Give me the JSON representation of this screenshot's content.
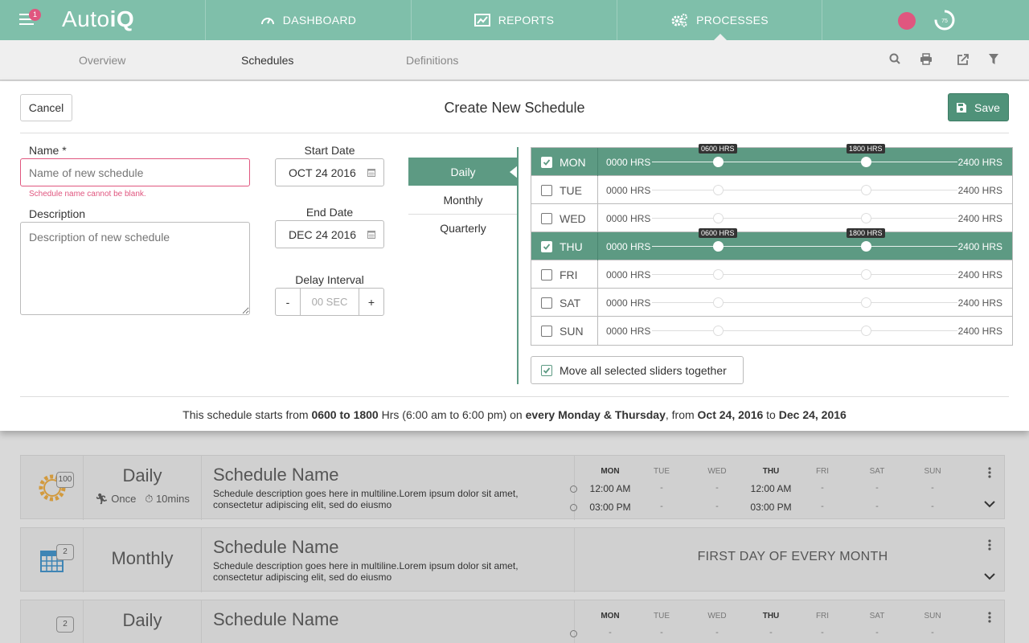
{
  "app": {
    "logo_plain": "Auto",
    "logo_bold": "iQ",
    "notification_count": "1",
    "progress_value": "75",
    "accent_color": "#7fbfaa",
    "alert_color": "#e0567f"
  },
  "nav": {
    "dashboard": "DASHBOARD",
    "reports": "REPORTS",
    "processes": "PROCESSES",
    "active": "PROCESSES"
  },
  "subnav": {
    "overview": "Overview",
    "schedules": "Schedules",
    "definitions": "Definitions",
    "active": "Schedules",
    "icons": [
      "search-icon",
      "print-icon",
      "export-icon",
      "filter-icon"
    ]
  },
  "modal": {
    "cancel_label": "Cancel",
    "title": "Create New Schedule",
    "save_label": "Save",
    "name_label": "Name *",
    "name_placeholder": "Name of new schedule",
    "name_error": "Schedule name cannot be blank.",
    "description_label": "Description",
    "description_placeholder": "Description of new schedule",
    "start_date_label": "Start Date",
    "start_date_value": "OCT 24 2016",
    "end_date_label": "End Date",
    "end_date_value": "DEC 24 2016",
    "delay_label": "Delay Interval",
    "delay_minus": "-",
    "delay_placeholder": "00 SEC",
    "delay_plus": "+",
    "frequency_tabs": [
      "Daily",
      "Monthly",
      "Quarterly"
    ],
    "frequency_active": "Daily",
    "days": [
      {
        "label": "MON",
        "checked": true,
        "start": "0000 HRS",
        "end": "2400 HRS",
        "from": "0600 HRS",
        "to": "1800 HRS"
      },
      {
        "label": "TUE",
        "checked": false,
        "start": "0000 HRS",
        "end": "2400 HRS"
      },
      {
        "label": "WED",
        "checked": false,
        "start": "0000 HRS",
        "end": "2400 HRS"
      },
      {
        "label": "THU",
        "checked": true,
        "start": "0000 HRS",
        "end": "2400 HRS",
        "from": "0600 HRS",
        "to": "1800 HRS"
      },
      {
        "label": "FRI",
        "checked": false,
        "start": "0000 HRS",
        "end": "2400 HRS"
      },
      {
        "label": "SAT",
        "checked": false,
        "start": "0000 HRS",
        "end": "2400 HRS"
      },
      {
        "label": "SUN",
        "checked": false,
        "start": "0000 HRS",
        "end": "2400 HRS"
      }
    ],
    "slider_from_hours": 6,
    "slider_to_hours": 18,
    "move_together_label": "Move all selected sliders together",
    "move_together_checked": true,
    "summary": {
      "p1": "This schedule starts from ",
      "b1": "0600 to 1800",
      "p2": " Hrs (6:00 am to 6:00 pm) on ",
      "b2": "every Monday & Thursday",
      "p3": ", from ",
      "b3": "Oct 24, 2016",
      "p4": " to ",
      "b4": "Dec 24, 2016"
    }
  },
  "list": {
    "weekdays": [
      "MON",
      "TUE",
      "WED",
      "THU",
      "FRI",
      "SAT",
      "SUN"
    ],
    "items": [
      {
        "count": "100",
        "type": "Daily",
        "mode": "Once",
        "interval": "10mins",
        "name": "Schedule Name",
        "description": "Schedule description goes here in multiline.Lorem ipsum dolor sit amet, consectetur adipiscing elit, sed do eiusmo",
        "rows": [
          [
            "12:00 AM",
            "-",
            "-",
            "12:00 AM",
            "-",
            "-",
            "-"
          ],
          [
            "03:00 PM",
            "-",
            "-",
            "03:00 PM",
            "-",
            "-",
            "-"
          ]
        ]
      },
      {
        "count": "2",
        "type": "Monthly",
        "name": "Schedule Name",
        "description": "Schedule description goes here in multiline.Lorem ipsum dolor sit amet, consectetur adipiscing elit, sed do eiusmo",
        "monthly_text": "FIRST DAY OF EVERY MONTH"
      },
      {
        "count": "2",
        "type": "Daily",
        "name": "Schedule Name",
        "rows": [
          [
            "-",
            "-",
            "-",
            "-",
            "-",
            "-",
            "-"
          ]
        ]
      }
    ]
  }
}
